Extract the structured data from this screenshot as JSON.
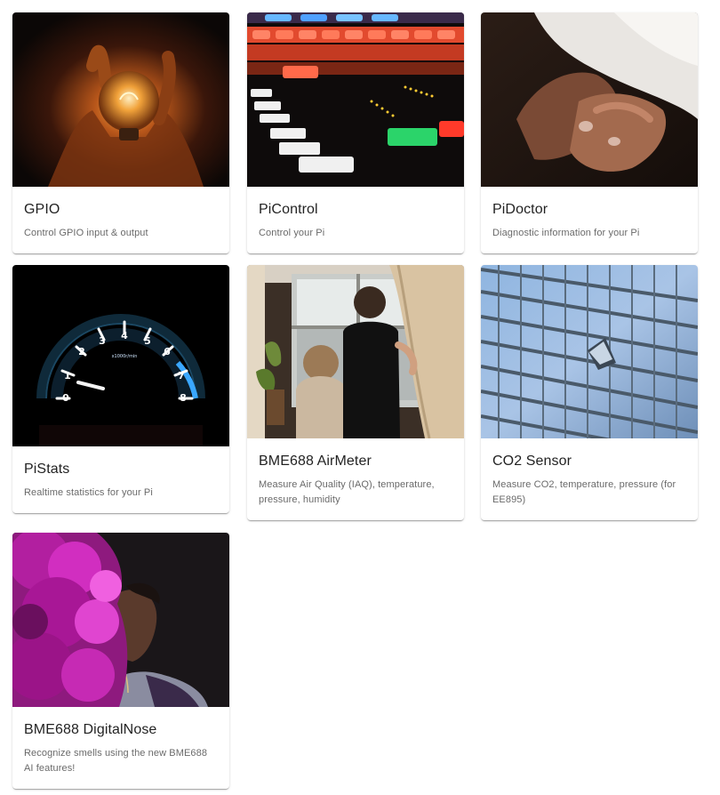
{
  "cards": [
    {
      "title": "GPIO",
      "description": "Control GPIO input & output",
      "image": "lightbulb-in-hand-photo"
    },
    {
      "title": "PiControl",
      "description": "Control your Pi",
      "image": "mixing-console-photo"
    },
    {
      "title": "PiDoctor",
      "description": "Diagnostic information for your Pi",
      "image": "holding-hands-photo"
    },
    {
      "title": "PiStats",
      "description": "Realtime statistics for your Pi",
      "image": "tachometer-photo",
      "gauge": {
        "ticks": [
          "0",
          "1",
          "2",
          "3",
          "4",
          "5",
          "6",
          "7",
          "8"
        ],
        "unit": "x1000r/min"
      }
    },
    {
      "title": "BME688 AirMeter",
      "description": "Measure Air Quality (IAQ), temperature, pressure, humidity",
      "image": "children-at-window-photo"
    },
    {
      "title": "CO2 Sensor",
      "description": "Measure CO2, temperature, pressure (for EE895)",
      "image": "glass-facade-photo"
    },
    {
      "title": "BME688 DigitalNose",
      "description": "Recognize smells using the new BME688 AI features!",
      "image": "purple-smoke-portrait-photo"
    }
  ]
}
